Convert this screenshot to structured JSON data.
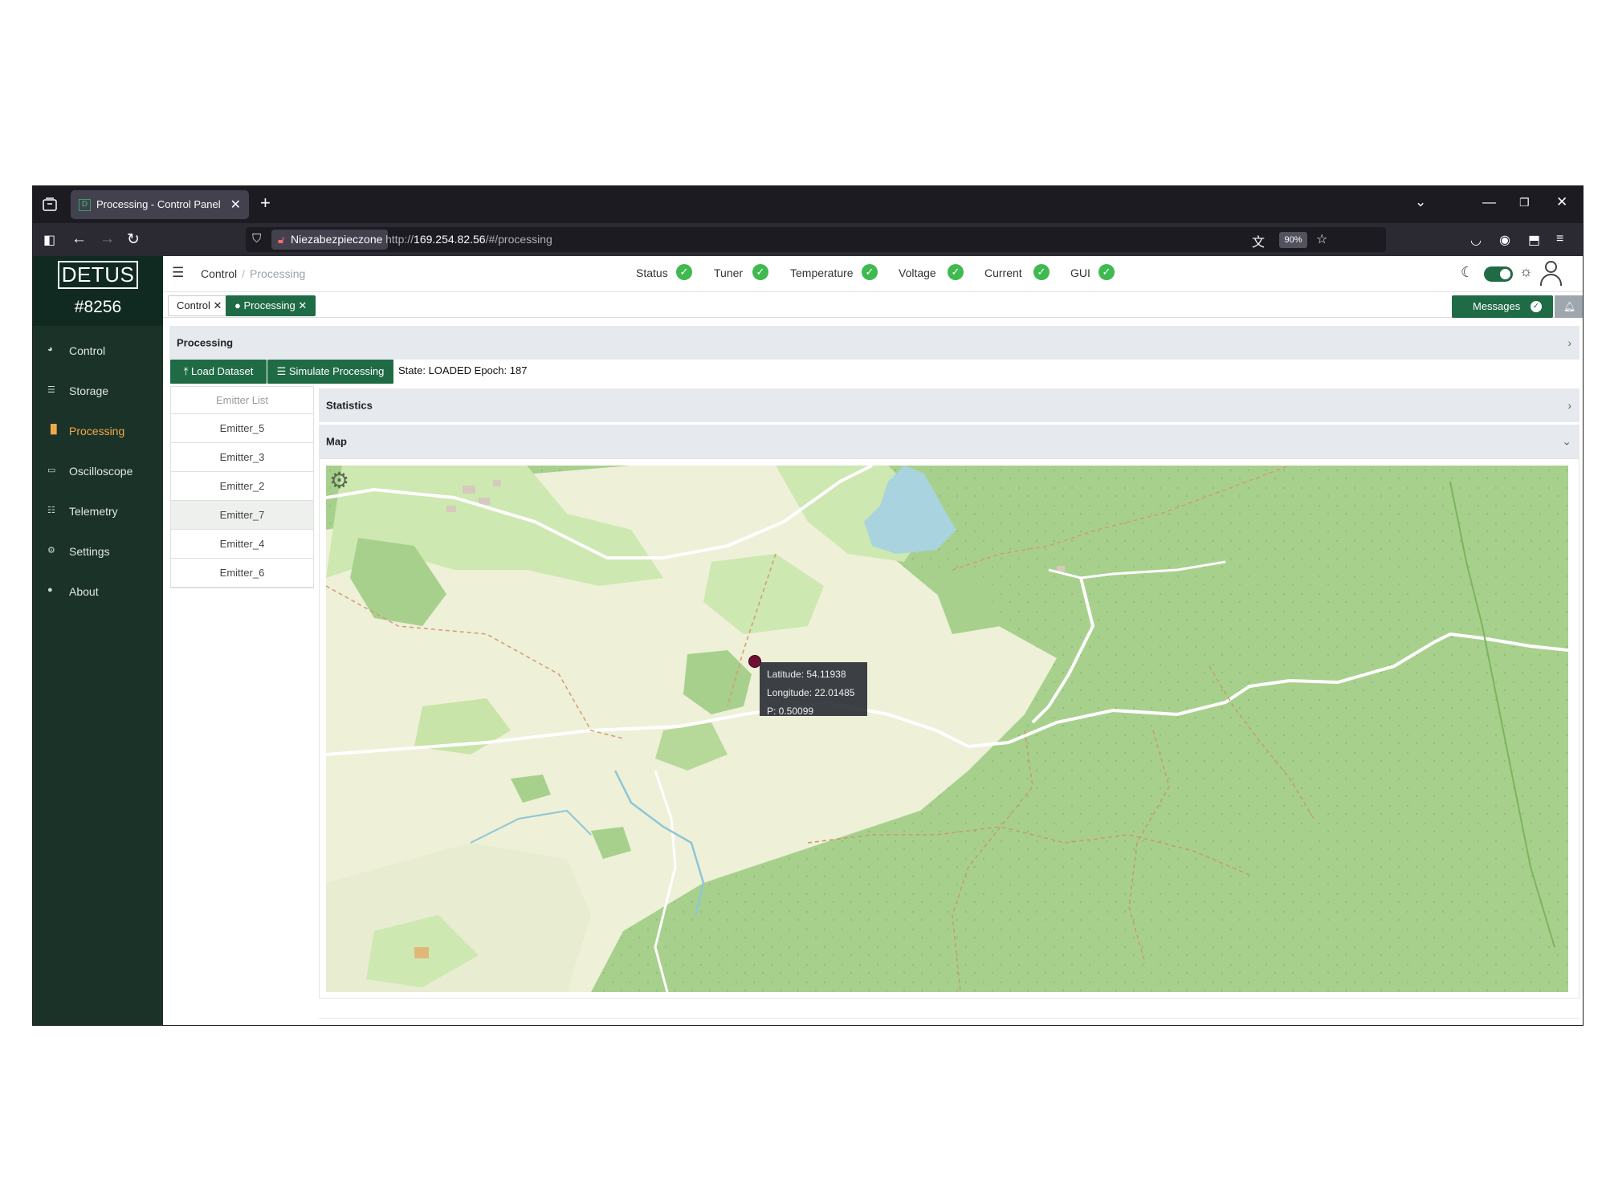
{
  "browser": {
    "tab_title": "Processing - Control Panel",
    "favicon_letter": "D",
    "security_label": "Niezabezpieczone",
    "url_prefix": "http://",
    "url_host": "169.254.82.56",
    "url_path": "/#/processing",
    "zoom": "90%"
  },
  "sidebar": {
    "logo": "DETUS",
    "device_id": "#8256",
    "items": [
      {
        "label": "Control",
        "icon": "dashboard-icon"
      },
      {
        "label": "Storage",
        "icon": "database-icon"
      },
      {
        "label": "Processing",
        "icon": "bar-chart-icon",
        "active": true
      },
      {
        "label": "Oscilloscope",
        "icon": "monitor-icon"
      },
      {
        "label": "Telemetry",
        "icon": "list-icon"
      },
      {
        "label": "Settings",
        "icon": "gear-icon"
      },
      {
        "label": "About",
        "icon": "info-icon"
      }
    ]
  },
  "header": {
    "breadcrumb_root": "Control",
    "breadcrumb_current": "Processing",
    "status": [
      {
        "label": "Status",
        "ok": true
      },
      {
        "label": "Tuner",
        "ok": true
      },
      {
        "label": "Temperature",
        "ok": true
      },
      {
        "label": "Voltage",
        "ok": true
      },
      {
        "label": "Current",
        "ok": true
      },
      {
        "label": "GUI",
        "ok": true
      }
    ]
  },
  "page_tabs": {
    "tabs": [
      {
        "label": "Control ✕"
      },
      {
        "label": "● Processing ✕",
        "active": true
      }
    ],
    "messages_label": "Messages"
  },
  "processing": {
    "section_title": "Processing",
    "load_dataset_label": "⤒ Load Dataset",
    "simulate_label": "☰ Simulate Processing",
    "state_text": "State: LOADED Epoch: 187",
    "emitter_list_title": "Emitter List",
    "emitters": [
      "Emitter_5",
      "Emitter_3",
      "Emitter_2",
      "Emitter_7",
      "Emitter_4",
      "Emitter_6"
    ],
    "selected_emitter": "Emitter_7",
    "statistics_title": "Statistics",
    "map_title": "Map"
  },
  "map": {
    "tooltip": {
      "latitude": "Latitude: 54.11938",
      "longitude": "Longitude: 22.01485",
      "p": "P: 0.50099"
    },
    "colors": {
      "forest": "#a8d08d",
      "meadow": "#eef0d8",
      "field": "#cde8b0",
      "water": "#a9d3df",
      "marker": "#6e0f33"
    }
  }
}
